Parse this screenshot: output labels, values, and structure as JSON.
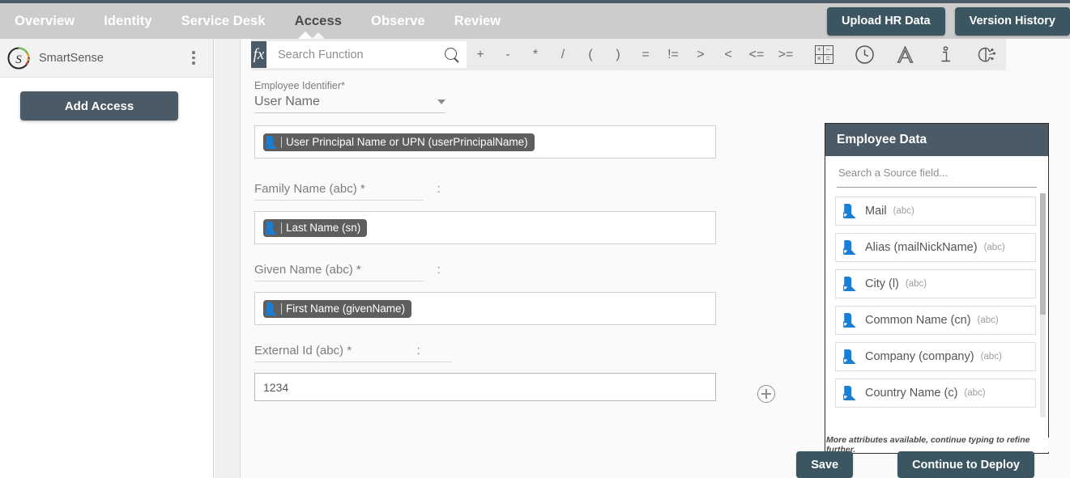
{
  "topnav": {
    "tabs": [
      {
        "label": "Overview",
        "active": false
      },
      {
        "label": "Identity",
        "active": false
      },
      {
        "label": "Service Desk",
        "active": false
      },
      {
        "label": "Access",
        "active": true
      },
      {
        "label": "Observe",
        "active": false
      },
      {
        "label": "Review",
        "active": false
      }
    ],
    "upload_label": "Upload HR Data",
    "version_label": "Version History"
  },
  "sidebar": {
    "app_name": "SmartSense",
    "menu_icon": "kebab-menu-icon",
    "add_access_label": "Add Access"
  },
  "toolbar": {
    "fx_label": "fx",
    "search_placeholder": "Search Function",
    "search_value": "",
    "search_icon": "search-icon",
    "operators": [
      "+",
      "-",
      "*",
      "/",
      "(",
      ")",
      "=",
      "!=",
      ">",
      "<",
      "<=",
      ">="
    ],
    "calc_icon_cells": [
      "+",
      "−",
      "×",
      "="
    ],
    "icons": [
      {
        "name": "calculator-icon"
      },
      {
        "name": "clock-icon"
      },
      {
        "name": "text-format-icon",
        "glyph": "A"
      },
      {
        "name": "info-icon",
        "glyph": "i"
      },
      {
        "name": "ai-brain-icon"
      }
    ]
  },
  "form": {
    "identifier_label": "Employee Identifier*",
    "identifier_value": "User Name",
    "upn_chip": "User Principal Name or UPN (userPrincipalName)",
    "rows": [
      {
        "label": "Family Name (abc) *",
        "colon": ":",
        "chip": "Last Name (sn)"
      },
      {
        "label": "Given Name (abc) *",
        "colon": ":",
        "chip": "First Name (givenName)"
      },
      {
        "label": "External Id (abc) *",
        "colon": ":",
        "value": "1234"
      }
    ],
    "add_row_icon": "plus-circle-icon"
  },
  "employee_data": {
    "title": "Employee Data",
    "search_placeholder": "Search a Source field...",
    "fields": [
      {
        "name": "Mail",
        "type": "(abc)"
      },
      {
        "name": "Alias (mailNickName)",
        "type": "(abc)"
      },
      {
        "name": "City (l)",
        "type": "(abc)"
      },
      {
        "name": "Common Name (cn)",
        "type": "(abc)"
      },
      {
        "name": "Company (company)",
        "type": "(abc)"
      },
      {
        "name": "Country Name (c)",
        "type": "(abc)"
      }
    ],
    "footer_note": "More attributes available, continue typing to refine further."
  },
  "footer": {
    "save_label": "Save",
    "deploy_label": "Continue to Deploy"
  },
  "colors": {
    "nav_bg": "#cccccc",
    "dark_accent": "#4a5a66",
    "button_dark": "#3b5661",
    "chip_bg": "#5e5e5e",
    "source_icon_blue": "#1a7fd4",
    "canvas_bg": "#fafafa"
  }
}
